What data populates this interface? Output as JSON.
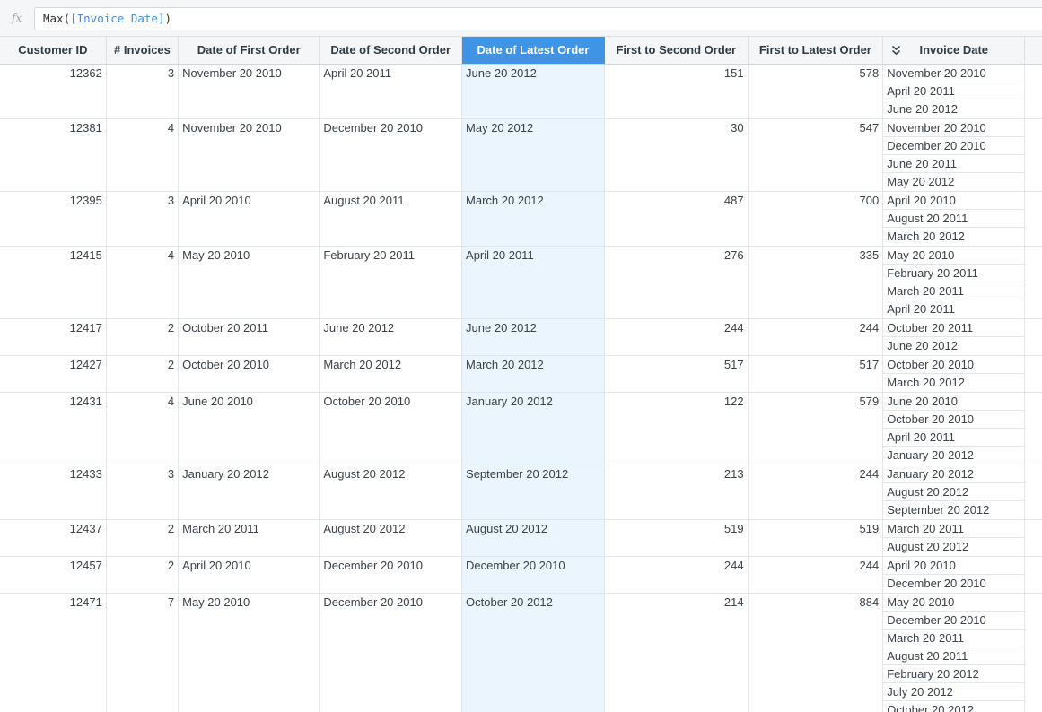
{
  "formula_bar": {
    "fx_label": "fx",
    "function_name": "Max(",
    "reference": "[Invoice Date]",
    "closing": ")"
  },
  "columns": [
    "Customer ID",
    "# Invoices",
    "Date of First Order",
    "Date of Second Order",
    "Date of Latest Order",
    "First to Second Order",
    "First to Latest Order",
    "Invoice Date"
  ],
  "selected_column": "Date of Latest Order",
  "rows": [
    {
      "customer_id": "12362",
      "invoices": "3",
      "first_order": "November 20 2010",
      "second_order": "April 20 2011",
      "latest_order": "June 20 2012",
      "first_to_second": "151",
      "first_to_latest": "578",
      "invoice_dates": [
        "November 20 2010",
        "April 20 2011",
        "June 20 2012"
      ]
    },
    {
      "customer_id": "12381",
      "invoices": "4",
      "first_order": "November 20 2010",
      "second_order": "December 20 2010",
      "latest_order": "May 20 2012",
      "first_to_second": "30",
      "first_to_latest": "547",
      "invoice_dates": [
        "November 20 2010",
        "December 20 2010",
        "June 20 2011",
        "May 20 2012"
      ]
    },
    {
      "customer_id": "12395",
      "invoices": "3",
      "first_order": "April 20 2010",
      "second_order": "August 20 2011",
      "latest_order": "March 20 2012",
      "first_to_second": "487",
      "first_to_latest": "700",
      "invoice_dates": [
        "April 20 2010",
        "August 20 2011",
        "March 20 2012"
      ]
    },
    {
      "customer_id": "12415",
      "invoices": "4",
      "first_order": "May 20 2010",
      "second_order": "February 20 2011",
      "latest_order": "April 20 2011",
      "first_to_second": "276",
      "first_to_latest": "335",
      "invoice_dates": [
        "May 20 2010",
        "February 20 2011",
        "March 20 2011",
        "April 20 2011"
      ]
    },
    {
      "customer_id": "12417",
      "invoices": "2",
      "first_order": "October 20 2011",
      "second_order": "June 20 2012",
      "latest_order": "June 20 2012",
      "first_to_second": "244",
      "first_to_latest": "244",
      "invoice_dates": [
        "October 20 2011",
        "June 20 2012"
      ]
    },
    {
      "customer_id": "12427",
      "invoices": "2",
      "first_order": "October 20 2010",
      "second_order": "March 20 2012",
      "latest_order": "March 20 2012",
      "first_to_second": "517",
      "first_to_latest": "517",
      "invoice_dates": [
        "October 20 2010",
        "March 20 2012"
      ]
    },
    {
      "customer_id": "12431",
      "invoices": "4",
      "first_order": "June 20 2010",
      "second_order": "October 20 2010",
      "latest_order": "January 20 2012",
      "first_to_second": "122",
      "first_to_latest": "579",
      "invoice_dates": [
        "June 20 2010",
        "October 20 2010",
        "April 20 2011",
        "January 20 2012"
      ]
    },
    {
      "customer_id": "12433",
      "invoices": "3",
      "first_order": "January 20 2012",
      "second_order": "August 20 2012",
      "latest_order": "September 20 2012",
      "first_to_second": "213",
      "first_to_latest": "244",
      "invoice_dates": [
        "January 20 2012",
        "August 20 2012",
        "September 20 2012"
      ]
    },
    {
      "customer_id": "12437",
      "invoices": "2",
      "first_order": "March 20 2011",
      "second_order": "August 20 2012",
      "latest_order": "August 20 2012",
      "first_to_second": "519",
      "first_to_latest": "519",
      "invoice_dates": [
        "March 20 2011",
        "August 20 2012"
      ]
    },
    {
      "customer_id": "12457",
      "invoices": "2",
      "first_order": "April 20 2010",
      "second_order": "December 20 2010",
      "latest_order": "December 20 2010",
      "first_to_second": "244",
      "first_to_latest": "244",
      "invoice_dates": [
        "April 20 2010",
        "December 20 2010"
      ]
    },
    {
      "customer_id": "12471",
      "invoices": "7",
      "first_order": "May 20 2010",
      "second_order": "December 20 2010",
      "latest_order": "October 20 2012",
      "first_to_second": "214",
      "first_to_latest": "884",
      "invoice_dates": [
        "May 20 2010",
        "December 20 2010",
        "March 20 2011",
        "August 20 2011",
        "February 20 2012",
        "July 20 2012",
        "October 20 2012"
      ]
    }
  ]
}
